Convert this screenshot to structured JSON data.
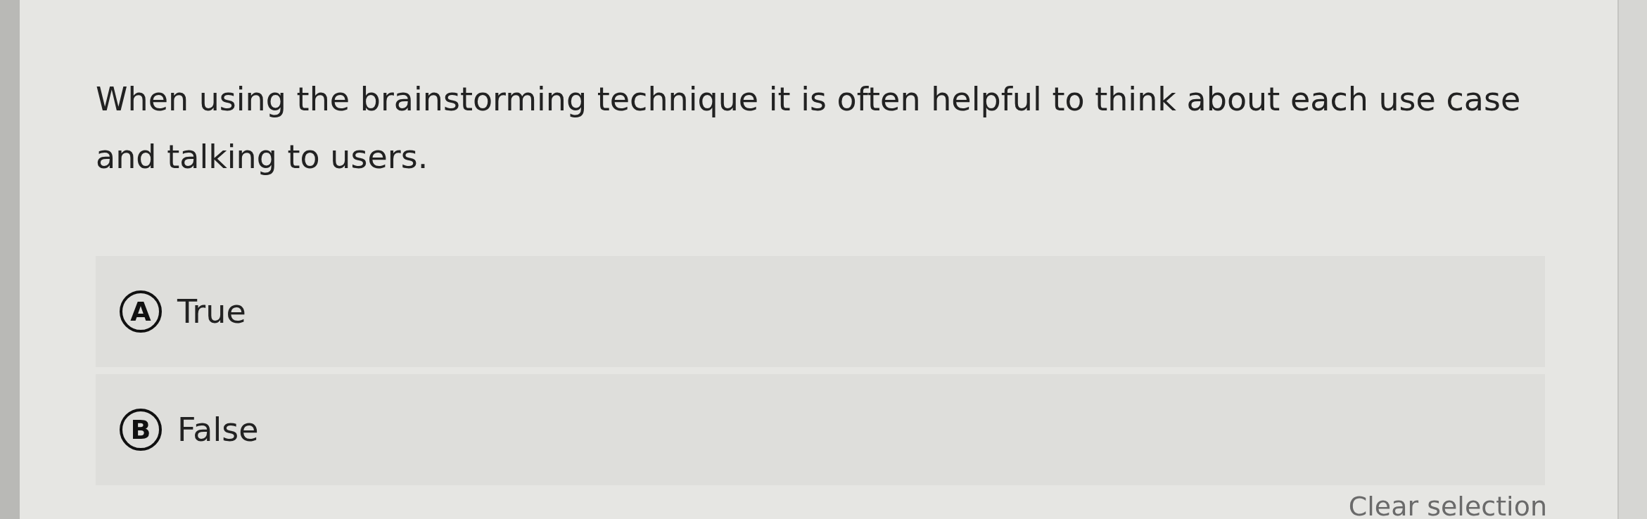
{
  "question": "When using the brainstorming technique it is often helpful to think about each use case and talking to users.",
  "options": [
    {
      "letter": "A",
      "label": "True"
    },
    {
      "letter": "B",
      "label": "False"
    }
  ],
  "clear_link": "Clear selection"
}
